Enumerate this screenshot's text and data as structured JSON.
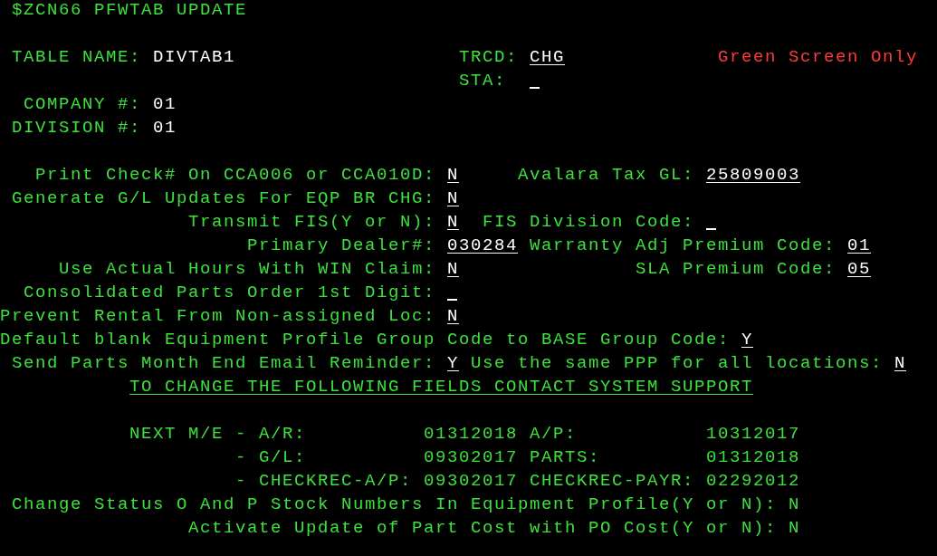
{
  "rows": [
    {
      "items": [
        {
          "kind": "title",
          "text": "$ZCN66 PFWTAB UPDATE"
        }
      ]
    },
    {
      "items": [
        {
          "kind": "label",
          "text": "TABLE NAME:"
        },
        {
          "kind": "output",
          "text": "DIVTAB1"
        },
        {
          "kind": "label",
          "text": "TRCD:"
        },
        {
          "kind": "input",
          "text": "CHG"
        },
        {
          "kind": "warning",
          "text": "Green Screen Only"
        }
      ]
    },
    {
      "items": [
        {
          "kind": "label",
          "text": "STA:"
        },
        {
          "kind": "input"
        }
      ]
    },
    {
      "items": [
        {
          "kind": "label",
          "text": "COMPANY #:"
        },
        {
          "kind": "output",
          "text": "01"
        }
      ]
    },
    {
      "items": [
        {
          "kind": "label",
          "text": "DIVISION #:"
        },
        {
          "kind": "output",
          "text": "01"
        }
      ]
    },
    {
      "items": [
        {
          "kind": "label",
          "text": "Print Check# On CCA006 or CCA010D:"
        },
        {
          "kind": "input",
          "text": "N"
        },
        {
          "kind": "label",
          "text": "Avalara Tax GL:"
        },
        {
          "kind": "input",
          "text": "25809003"
        }
      ]
    },
    {
      "items": [
        {
          "kind": "label",
          "text": "Generate G/L Updates For EQP BR CHG:"
        },
        {
          "kind": "input",
          "text": "N"
        }
      ]
    },
    {
      "items": [
        {
          "kind": "label",
          "text": "Transmit FIS(Y or N):"
        },
        {
          "kind": "input",
          "text": "N"
        },
        {
          "kind": "label",
          "text": "FIS Division Code:"
        },
        {
          "kind": "input"
        }
      ]
    },
    {
      "items": [
        {
          "kind": "label",
          "text": "Primary Dealer#:"
        },
        {
          "kind": "input",
          "text": "030284"
        },
        {
          "kind": "label",
          "text": "Warranty Adj Premium Code:"
        },
        {
          "kind": "input",
          "text": "01"
        }
      ]
    },
    {
      "items": [
        {
          "kind": "label",
          "text": "Use Actual Hours With WIN Claim:"
        },
        {
          "kind": "input",
          "text": "N"
        },
        {
          "kind": "label",
          "text": "SLA Premium Code:"
        },
        {
          "kind": "input",
          "text": "05"
        }
      ]
    },
    {
      "items": [
        {
          "kind": "label",
          "text": "Consolidated Parts Order 1st Digit:"
        },
        {
          "kind": "input"
        }
      ]
    },
    {
      "items": [
        {
          "kind": "label",
          "text": "Prevent Rental From Non-assigned Loc:"
        },
        {
          "kind": "input",
          "text": "N"
        }
      ]
    },
    {
      "items": [
        {
          "kind": "label",
          "text": "Default blank Equipment Profile Group Code to BASE Group Code:"
        },
        {
          "kind": "input",
          "text": "Y"
        }
      ]
    },
    {
      "items": [
        {
          "kind": "label",
          "text": "Send Parts Month End Email Reminder:"
        },
        {
          "kind": "input",
          "text": "Y"
        },
        {
          "kind": "label",
          "text": "Use the same PPP for all locations:"
        },
        {
          "kind": "input",
          "text": "N"
        }
      ]
    },
    {
      "items": [
        {
          "kind": "notice",
          "text": "TO CHANGE THE FOLLOWING FIELDS CONTACT SYSTEM SUPPORT"
        }
      ]
    },
    {
      "items": [
        {
          "kind": "label",
          "text": "NEXT M/E - A/R:"
        },
        {
          "kind": "value",
          "text": "01312018"
        },
        {
          "kind": "label",
          "text": "A/P:"
        },
        {
          "kind": "value",
          "text": "10312017"
        }
      ]
    },
    {
      "items": [
        {
          "kind": "label",
          "text": "- G/L:"
        },
        {
          "kind": "value",
          "text": "09302017"
        },
        {
          "kind": "label",
          "text": "PARTS:"
        },
        {
          "kind": "value",
          "text": "01312018"
        }
      ]
    },
    {
      "items": [
        {
          "kind": "label",
          "text": "- CHECKREC-A/P:"
        },
        {
          "kind": "value",
          "text": "09302017"
        },
        {
          "kind": "label",
          "text": "CHECKREC-PAYR:"
        },
        {
          "kind": "value",
          "text": "02292012"
        }
      ]
    },
    {
      "items": [
        {
          "kind": "label",
          "text": "Change Status O And P Stock Numbers In Equipment Profile(Y or N):"
        },
        {
          "kind": "value",
          "text": "N"
        }
      ]
    },
    {
      "items": [
        {
          "kind": "label",
          "text": "Activate Update of Part Cost with PO Cost(Y or N):"
        },
        {
          "kind": "value",
          "text": "N"
        }
      ]
    }
  ]
}
